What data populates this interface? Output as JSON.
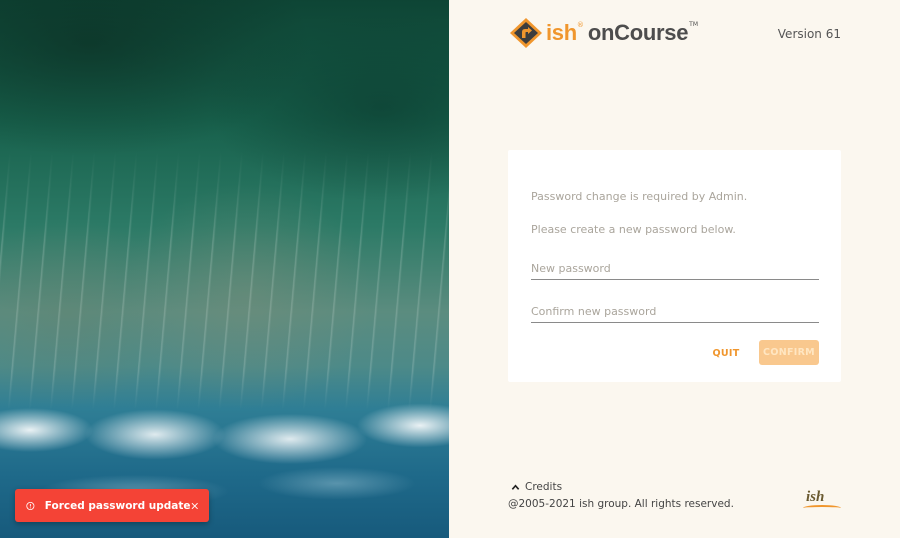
{
  "header": {
    "brand_ish": "ish",
    "brand_reg": "®",
    "brand_product": "onCourse",
    "brand_tm": "TM",
    "version": "Version 61"
  },
  "form": {
    "message_line1": "Password change is required by Admin.",
    "message_line2": "Please create a new password below.",
    "new_password_placeholder": "New password",
    "new_password_value": "",
    "confirm_password_placeholder": "Confirm new password",
    "confirm_password_value": "",
    "quit_label": "QUIT",
    "confirm_label": "CONFIRM",
    "confirm_enabled": false
  },
  "footer": {
    "credits_label": "Credits",
    "copyright": "@2005-2021 ish group. All rights reserved.",
    "logo_text": "ish"
  },
  "snackbar": {
    "message": "Forced password update",
    "icon": "alert-circle-icon",
    "close_icon": "close-icon"
  },
  "colors": {
    "accent": "#f0962d",
    "confirm_disabled_bg": "#f9c88e",
    "snackbar_bg": "#f44336",
    "page_bg": "#fbf7ef"
  }
}
